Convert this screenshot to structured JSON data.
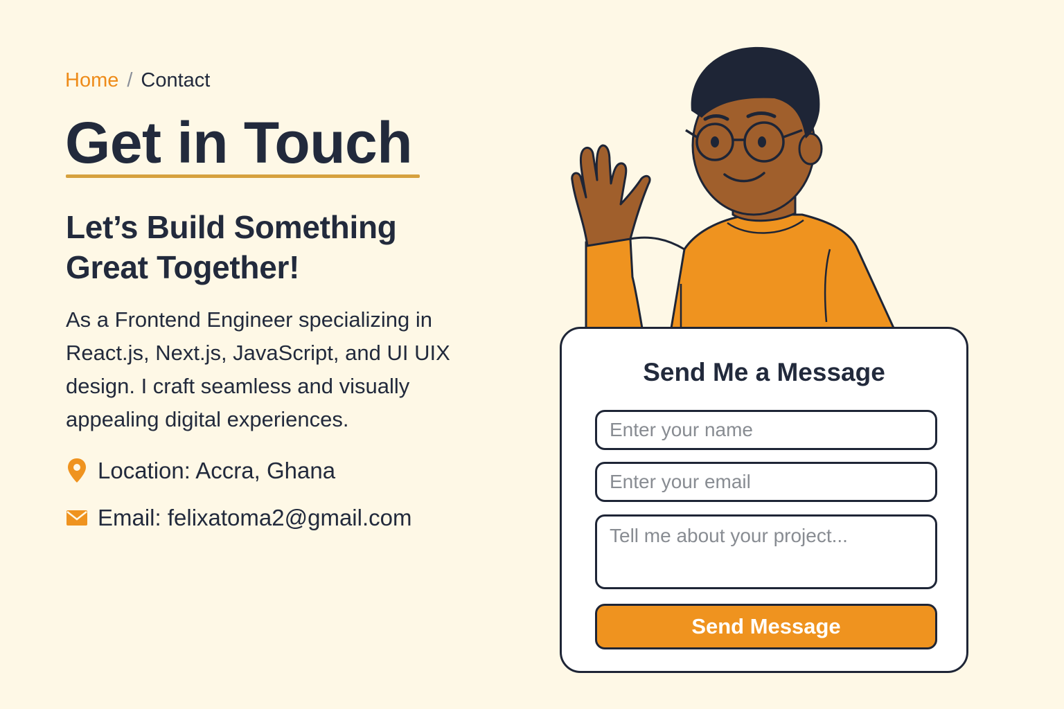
{
  "breadcrumb": {
    "home": "Home",
    "separator": "/",
    "current": "Contact"
  },
  "hero": {
    "title": "Get in Touch",
    "subtitle": "Let’s Build Something Great Together!",
    "description": "As a Frontend Engineer specializing in React.js, Next.js, JavaScript, and UI UIX design. I craft seamless and visually appealing digital experiences."
  },
  "contact": {
    "location": "Location: Accra, Ghana",
    "email": "Email: felixatoma2@gmail.com",
    "location_icon": "map-pin-icon",
    "email_icon": "envelope-icon"
  },
  "form": {
    "title": "Send Me a Message",
    "name_placeholder": "Enter your name",
    "email_placeholder": "Enter your email",
    "message_placeholder": "Tell me about your project...",
    "submit_label": "Send Message"
  },
  "colors": {
    "background": "#fef8e6",
    "accent": "#ef931f",
    "text": "#222a3c",
    "underline": "#d6a13e"
  }
}
